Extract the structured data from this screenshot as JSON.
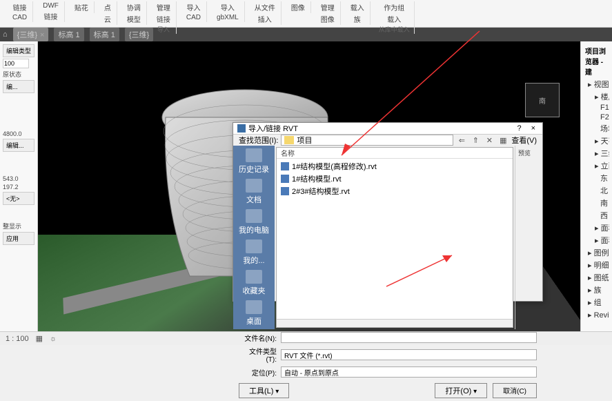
{
  "ribbon": {
    "groups": [
      {
        "items": [
          "链接",
          "CAD"
        ],
        "label": ""
      },
      {
        "items": [
          "DWF",
          "链接"
        ],
        "label": ""
      },
      {
        "items": [
          "贴花"
        ],
        "label": ""
      },
      {
        "items": [
          "点",
          "云"
        ],
        "label": ""
      },
      {
        "items": [
          "协调",
          "模型"
        ],
        "label": ""
      },
      {
        "items": [
          "管理",
          "链接"
        ],
        "label": "导入"
      },
      {
        "items": [
          "导入",
          "CAD"
        ],
        "label": ""
      },
      {
        "items": [
          "导入",
          "gbXML"
        ],
        "label": ""
      },
      {
        "items": [
          "从文件",
          "插入"
        ],
        "label": ""
      },
      {
        "items": [
          "图像"
        ],
        "label": ""
      },
      {
        "items": [
          "管理",
          "图像"
        ],
        "label": "»"
      },
      {
        "items": [
          "载入",
          "族"
        ],
        "label": ""
      },
      {
        "items": [
          "作为组",
          "载入"
        ],
        "label": "从库中载入"
      }
    ]
  },
  "tabs": {
    "items": [
      {
        "label": "{三维}",
        "active": true
      },
      {
        "label": "标高 1"
      },
      {
        "label": "标高 1"
      },
      {
        "label": "{三维}"
      }
    ]
  },
  "leftPanel": {
    "btn1": "编辑类型",
    "val1": "100",
    "txt1": "原状态",
    "btn2": "编...",
    "val2": "4800.0",
    "btn3": "编辑...",
    "val3": "543.0",
    "val4": "197.2",
    "combo": "<无>",
    "chk1": "整显示",
    "btn4": "应用"
  },
  "viewcube": {
    "label": "南"
  },
  "rightPanel": {
    "title": "项目浏览器 - 建",
    "tree": [
      {
        "t": "视图 (全",
        "i": 0
      },
      {
        "t": "楼层平面",
        "i": 1
      },
      {
        "t": "F1",
        "i": 2
      },
      {
        "t": "F2",
        "i": 2
      },
      {
        "t": "场地",
        "i": 2
      },
      {
        "t": "天花板平",
        "i": 1
      },
      {
        "t": "三维视图",
        "i": 1
      },
      {
        "t": "立面 (建",
        "i": 1
      },
      {
        "t": "东",
        "i": 2
      },
      {
        "t": "北",
        "i": 2
      },
      {
        "t": "南",
        "i": 2
      },
      {
        "t": "西",
        "i": 2
      },
      {
        "t": "面积平面",
        "i": 1
      },
      {
        "t": "面积平面",
        "i": 1
      },
      {
        "t": "图例",
        "i": 0
      },
      {
        "t": "明细表/表",
        "i": 0
      },
      {
        "t": "图纸 (全",
        "i": 0
      },
      {
        "t": "族",
        "i": 0
      },
      {
        "t": "组",
        "i": 0
      },
      {
        "t": "Revit 链接",
        "i": 0
      }
    ]
  },
  "dialog": {
    "title": "导入/链接 RVT",
    "help": "?",
    "close": "×",
    "lookLabel": "查找范围(I):",
    "lookValue": "项目",
    "viewBtn": "查看(V)",
    "nameHdr": "名称",
    "previewLabel": "预览",
    "side": [
      {
        "l": "历史记录"
      },
      {
        "l": "文档"
      },
      {
        "l": "我的电脑"
      },
      {
        "l": "我的..."
      },
      {
        "l": "收藏夹"
      },
      {
        "l": "桌面"
      }
    ],
    "files": [
      "1#结构模型(高程修改).rvt",
      "1#结构模型.rvt",
      "2#3#结构模型.rvt"
    ],
    "fileNameLbl": "文件名(N):",
    "fileNameVal": "",
    "fileTypeLbl": "文件类型(T):",
    "fileTypeVal": "RVT 文件 (*.rvt)",
    "posLbl": "定位(P):",
    "posVal": "自动 - 原点到原点",
    "toolsBtn": "工具(L)",
    "openBtn": "打开(O)",
    "cancelBtn": "取消(C)"
  },
  "status": {
    "scale": "1 : 100"
  }
}
